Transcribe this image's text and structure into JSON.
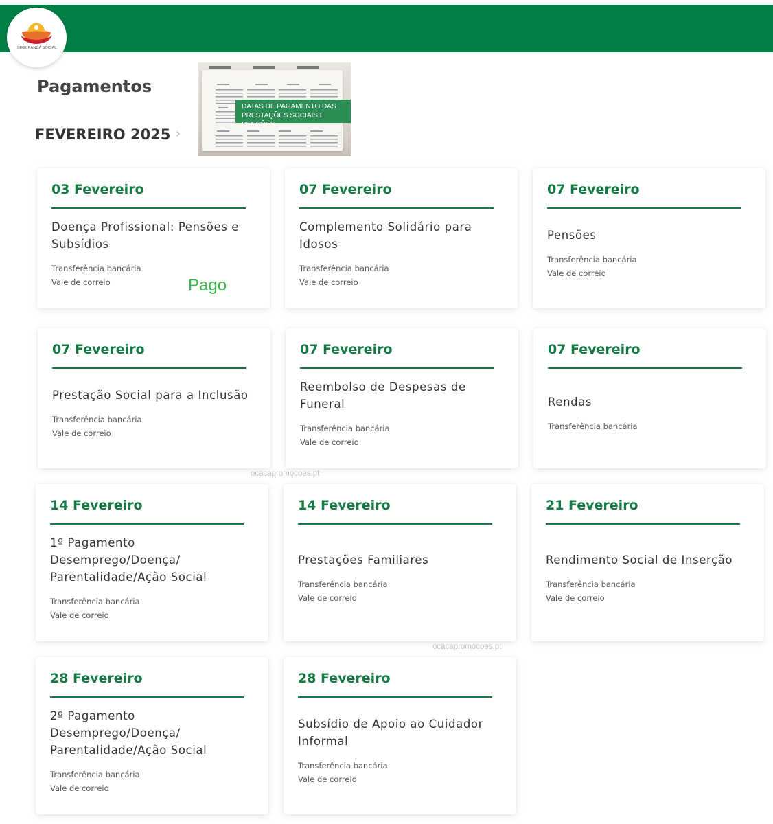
{
  "header": {
    "logo_text": "SEGURANÇA SOCIAL",
    "brand_color": "#007f45",
    "logo_icon": "seguranca-social-logo"
  },
  "page": {
    "title": "Pagamentos",
    "month": "FEVEREIRO 2025",
    "chevron_icon": "chevron-right-icon"
  },
  "banner": {
    "caption_line1": "DATAS DE PAGAMENTO DAS",
    "caption_line2": "PRESTAÇÕES SOCIAIS E PENSÕES"
  },
  "cards": [
    {
      "date": "03 Fevereiro",
      "title": "Doença Profissional: Pensões e Subsídios",
      "methods": [
        "Transferência bancária",
        "Vale de correio"
      ],
      "status": "Pago"
    },
    {
      "date": "07 Fevereiro",
      "title": "Complemento Solidário para Idosos",
      "methods": [
        "Transferência bancária",
        "Vale de correio"
      ]
    },
    {
      "date": "07 Fevereiro",
      "title": "Pensões",
      "methods": [
        "Transferência bancária",
        "Vale de correio"
      ]
    },
    {
      "date": "07 Fevereiro",
      "title": "Prestação Social para a Inclusão",
      "methods": [
        "Transferência bancária",
        "Vale de correio"
      ]
    },
    {
      "date": "07 Fevereiro",
      "title": "Reembolso de Despesas de Funeral",
      "methods": [
        "Transferência bancária",
        "Vale de correio"
      ]
    },
    {
      "date": "07 Fevereiro",
      "title": "Rendas",
      "methods": [
        "Transferência bancária"
      ]
    },
    {
      "date": "14 Fevereiro",
      "title": "1º Pagamento Desemprego/Doença/ Parentalidade/Ação Social",
      "methods": [
        "Transferência bancária",
        "Vale de correio"
      ]
    },
    {
      "date": "14 Fevereiro",
      "title": "Prestações Familiares",
      "methods": [
        "Transferência bancária",
        "Vale de correio"
      ]
    },
    {
      "date": "21 Fevereiro",
      "title": "Rendimento Social de Inserção",
      "methods": [
        "Transferência bancária",
        "Vale de correio"
      ]
    },
    {
      "date": "28 Fevereiro",
      "title": "2º Pagamento Desemprego/Doença/ Parentalidade/Ação Social",
      "methods": [
        "Transferência bancária",
        "Vale de correio"
      ]
    },
    {
      "date": "28 Fevereiro",
      "title": "Subsídio de Apoio ao Cuidador Informal",
      "methods": [
        "Transferência bancária",
        "Vale de correio"
      ]
    }
  ],
  "watermarks": [
    "ocacapromocoes.pt",
    "ocacapromocoes.pt"
  ]
}
